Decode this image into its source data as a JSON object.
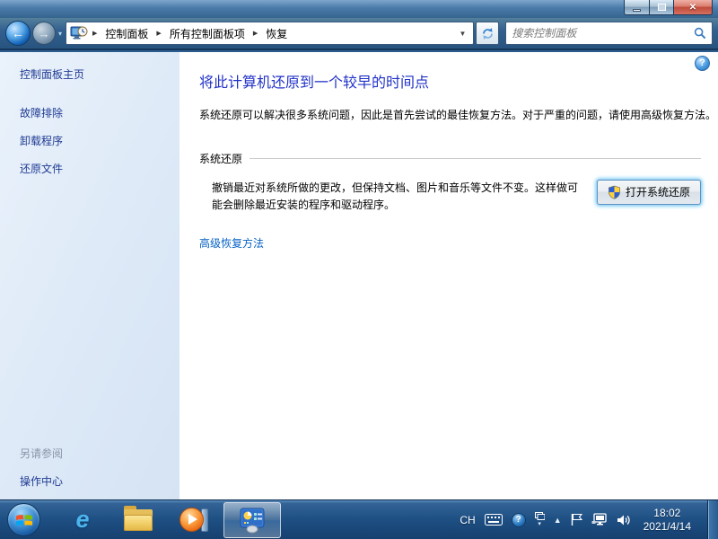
{
  "navbar": {
    "breadcrumb": {
      "root": "控制面板",
      "all_items": "所有控制面板项",
      "current": "恢复"
    },
    "search": {
      "placeholder": "搜索控制面板"
    }
  },
  "sidebar": {
    "home_label": "控制面板主页",
    "items": [
      {
        "label": "故障排除"
      },
      {
        "label": "卸载程序"
      },
      {
        "label": "还原文件"
      }
    ],
    "see_also": {
      "header": "另请参阅",
      "items": [
        {
          "label": "操作中心"
        }
      ]
    }
  },
  "main": {
    "heading": "将此计算机还原到一个较早的时间点",
    "intro": "系统还原可以解决很多系统问题，因此是首先尝试的最佳恢复方法。对于严重的问题，请使用高级恢复方法。",
    "system_restore": {
      "section_title": "系统还原",
      "description": "撤销最近对系统所做的更改，但保持文档、图片和音乐等文件不变。这样做可能会删除最近安装的程序和驱动程序。",
      "open_button_label": "打开系统还原"
    },
    "advanced_recovery_link": "高级恢复方法"
  },
  "taskbar": {
    "tray": {
      "language": "CH",
      "clock_time": "18:02",
      "clock_date": "2021/4/14"
    }
  },
  "icons": {
    "back_arrow": "←",
    "forward_arrow": "→",
    "chevron_small": "▾",
    "breadcrumb_arrow": "▶",
    "dropdown_arrow": "▼",
    "close": "✕",
    "help_mark": "?",
    "hidden_icons_arrow": "▲"
  },
  "colors": {
    "heading_blue": "#2132c8",
    "link_blue": "#0662c5",
    "sidebar_link": "#1f3a93",
    "see_also_grey": "#8795a8",
    "frame_blue": "#2d5e91",
    "taskbar_blue": "#1e4f83",
    "button_glow": "#53bff0"
  }
}
